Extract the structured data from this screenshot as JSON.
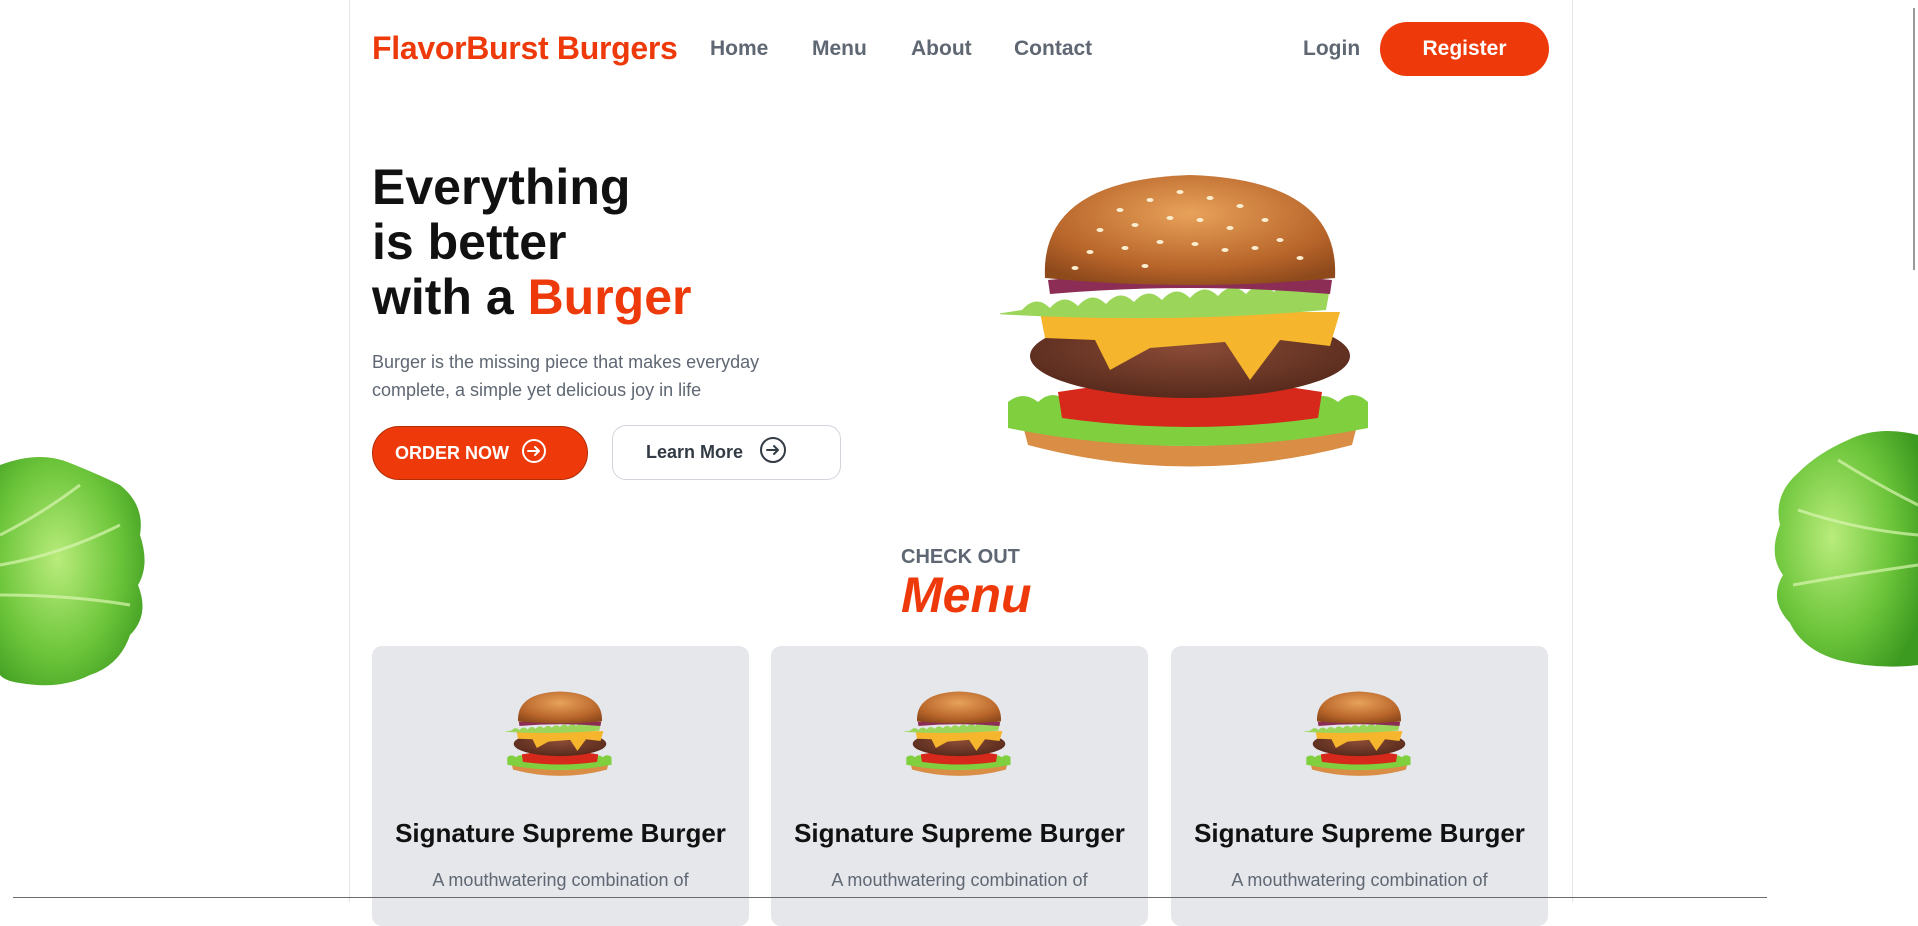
{
  "brand": {
    "name": "FlavorBurst Burgers",
    "accent": "#ee3a0a"
  },
  "nav": {
    "items": [
      "Home",
      "Menu",
      "About",
      "Contact"
    ],
    "login": "Login",
    "register": "Register"
  },
  "hero": {
    "line1": "Everything",
    "line2": "is better",
    "line3_prefix": "with a ",
    "line3_accent": "Burger",
    "description": "Burger is the missing piece that makes everyday complete, a simple yet delicious joy in life",
    "order_button": "ORDER NOW",
    "learn_button": "Learn More",
    "image_icon": "burger-image"
  },
  "menu_section": {
    "label": "CHECK OUT",
    "title": "Menu",
    "cards": [
      {
        "title": "Signature Supreme Burger",
        "desc": "A mouthwatering combination of"
      },
      {
        "title": "Signature Supreme Burger",
        "desc": "A mouthwatering combination of"
      },
      {
        "title": "Signature Supreme Burger",
        "desc": "A mouthwatering combination of"
      }
    ]
  },
  "decor": {
    "left": "lettuce-leaf-image",
    "right": "lettuce-leaf-image"
  }
}
